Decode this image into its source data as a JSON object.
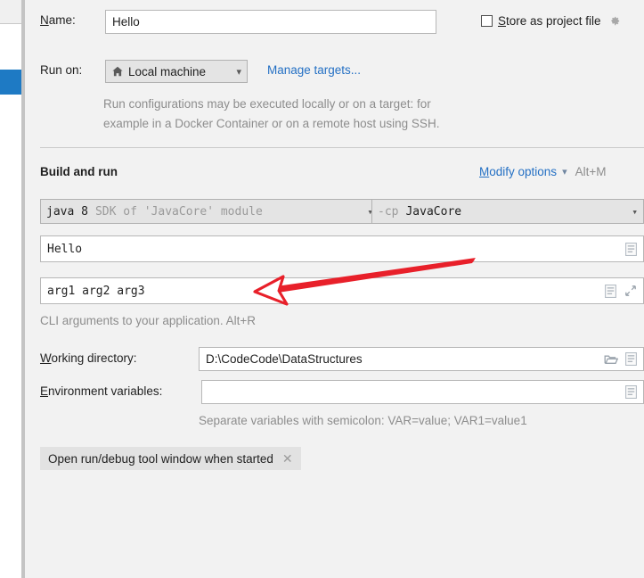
{
  "name_row": {
    "label": "Name:",
    "label_mnemonic": "N",
    "value": "Hello"
  },
  "store_as_project_file": {
    "label": "Store as project file",
    "label_mnemonic": "S",
    "checked": false,
    "gear_icon": "gear-icon"
  },
  "run_on_row": {
    "label": "Run on:",
    "selected": "Local machine",
    "machine_icon": "home-icon",
    "dropdown_icon": "chevron-down-icon",
    "manage_targets_link": "Manage targets...",
    "link_mnemonic": ""
  },
  "run_on_description": {
    "line1": "Run configurations may be executed locally or on a target: for",
    "line2": "example in a Docker Container or on a remote host using SSH."
  },
  "build_and_run": {
    "title": "Build and run",
    "modify_options_link": "Modify options",
    "modify_options_mnemonic": "M",
    "modify_options_chevron": "chevron-down-icon",
    "shortcut": "Alt+M"
  },
  "jre_combo": {
    "primary": "java 8",
    "secondary": "SDK of 'JavaCore' module",
    "dropdown_icon": "chevron-down-icon"
  },
  "classpath_combo": {
    "prefix": "-cp",
    "value": "JavaCore",
    "dropdown_icon": "chevron-down-icon"
  },
  "main_class_field": {
    "value": "Hello",
    "macro_icon": "macro-document-icon"
  },
  "program_arguments_field": {
    "value": "arg1 arg2 arg3",
    "macro_icon": "macro-document-icon",
    "expand_icon": "expand-diagonal-icon"
  },
  "program_arguments_hint": "CLI arguments to your application. Alt+R",
  "working_directory": {
    "label": "Working directory:",
    "label_mnemonic": "W",
    "value": "D:\\CodeCode\\DataStructures",
    "browse_icon": "folder-icon",
    "macro_icon": "macro-document-icon"
  },
  "environment_variables": {
    "label": "Environment variables:",
    "label_mnemonic": "E",
    "value": "",
    "browse_icon": "macro-document-icon"
  },
  "environment_variables_hint": "Separate variables with semicolon: VAR=value; VAR1=value1",
  "option_chip": {
    "label": "Open run/debug tool window when started",
    "close_icon": "close-icon"
  },
  "annotation": {
    "type": "arrow",
    "color": "#e8202a",
    "points_to": "program-arguments-field"
  },
  "colors": {
    "accent_blue": "#1e7ac4",
    "link_blue": "#2470c4",
    "panel_bg": "#f2f2f2",
    "field_bg": "#ffffff",
    "annotation_red": "#e8202a"
  }
}
